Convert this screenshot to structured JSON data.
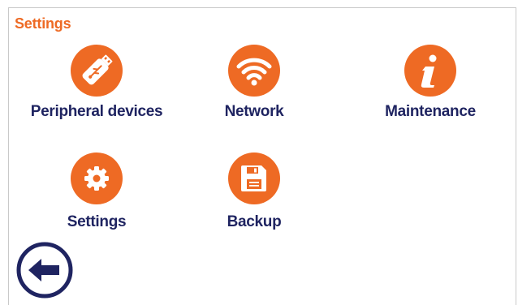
{
  "header": {
    "title": "Settings"
  },
  "tiles": [
    {
      "label": "Peripheral devices",
      "icon": "usb-stick-icon"
    },
    {
      "label": "Network",
      "icon": "wifi-icon"
    },
    {
      "label": "Maintenance",
      "icon": "info-icon"
    },
    {
      "label": "Settings",
      "icon": "gear-icon"
    },
    {
      "label": "Backup",
      "icon": "floppy-disk-icon"
    }
  ],
  "back": {
    "icon": "arrow-left-icon"
  },
  "colors": {
    "accent": "#ee6a24",
    "label": "#1f2461",
    "border": "#c9c9c9"
  }
}
